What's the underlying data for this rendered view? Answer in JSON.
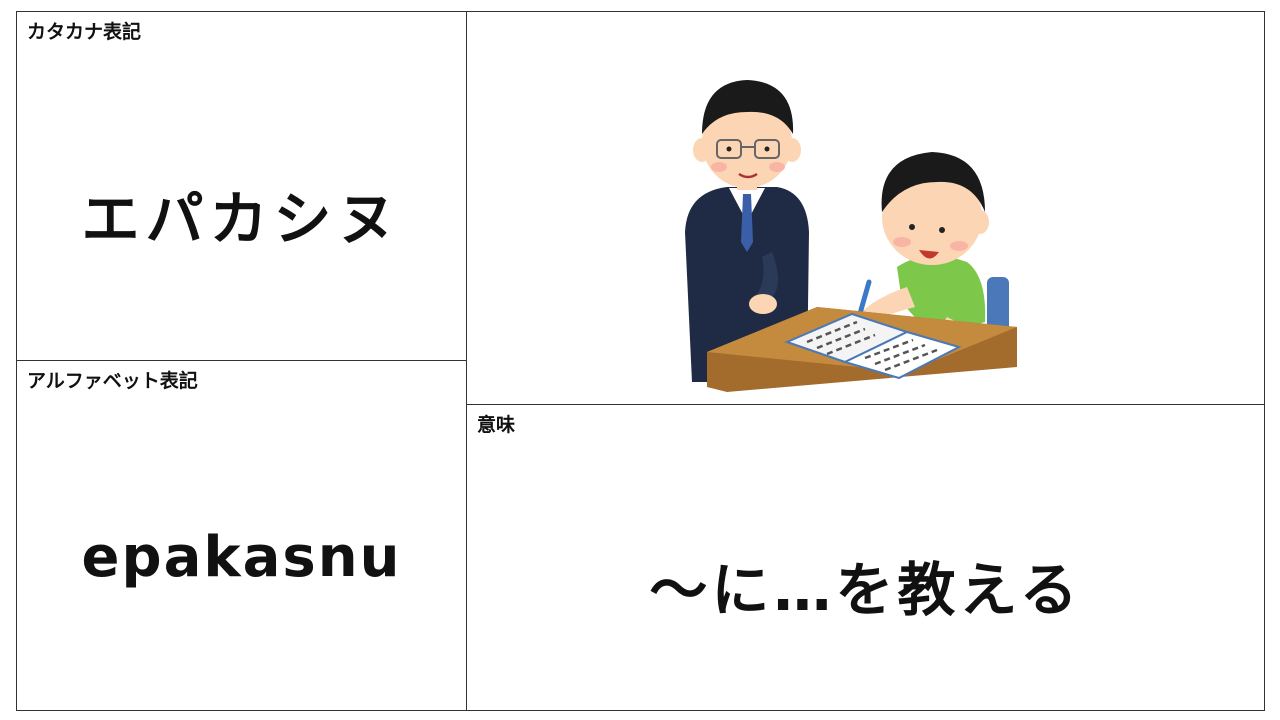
{
  "katakana": {
    "label": "カタカナ表記",
    "value": "エパカシヌ"
  },
  "alphabet": {
    "label": "アルファベット表記",
    "value": "epakasnu"
  },
  "meaning": {
    "label": "意味",
    "value": "～に…を教える"
  },
  "image": {
    "icon": "teacher-teaching-student-illustration"
  }
}
